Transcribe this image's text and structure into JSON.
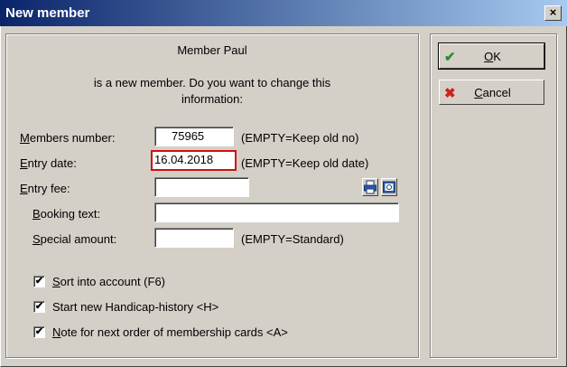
{
  "window": {
    "title": "New member",
    "close_label": "×"
  },
  "message": {
    "line1": "Member Paul",
    "line2": "is a new member. Do you want to change this",
    "line3": "information:"
  },
  "form": {
    "members_number": {
      "label_first": "M",
      "label_rest": "embers number:",
      "value": "75965",
      "hint": "(EMPTY=Keep old no)"
    },
    "entry_date": {
      "label_first": "E",
      "label_rest": "ntry date:",
      "value": "16.04.2018",
      "hint": "(EMPTY=Keep old date)"
    },
    "entry_fee": {
      "label_first": "E",
      "label_rest": "ntry fee:",
      "value": ""
    },
    "booking_text": {
      "label_first": "B",
      "label_rest": "ooking text:",
      "value": ""
    },
    "special_amount": {
      "label_first": "S",
      "label_rest": "pecial amount:",
      "value": "",
      "hint": "(EMPTY=Standard)"
    }
  },
  "checkboxes": [
    {
      "label_first": "S",
      "label_rest": "ort into account (F6)",
      "checked": true,
      "mark": "✔"
    },
    {
      "label_first": "",
      "label_rest": "Start new Handicap-history <H>",
      "checked": true,
      "mark": "✔"
    },
    {
      "label_first": "N",
      "label_rest": "ote for next order of membership cards <A>",
      "checked": true,
      "mark": "✔"
    }
  ],
  "buttons": {
    "ok": {
      "label_first": "O",
      "label_rest": "K",
      "icon": "✔",
      "icon_color": "#2e8b2e"
    },
    "cancel": {
      "label_first": "C",
      "label_rest": "ancel",
      "icon": "✖",
      "icon_color": "#d02020"
    }
  }
}
